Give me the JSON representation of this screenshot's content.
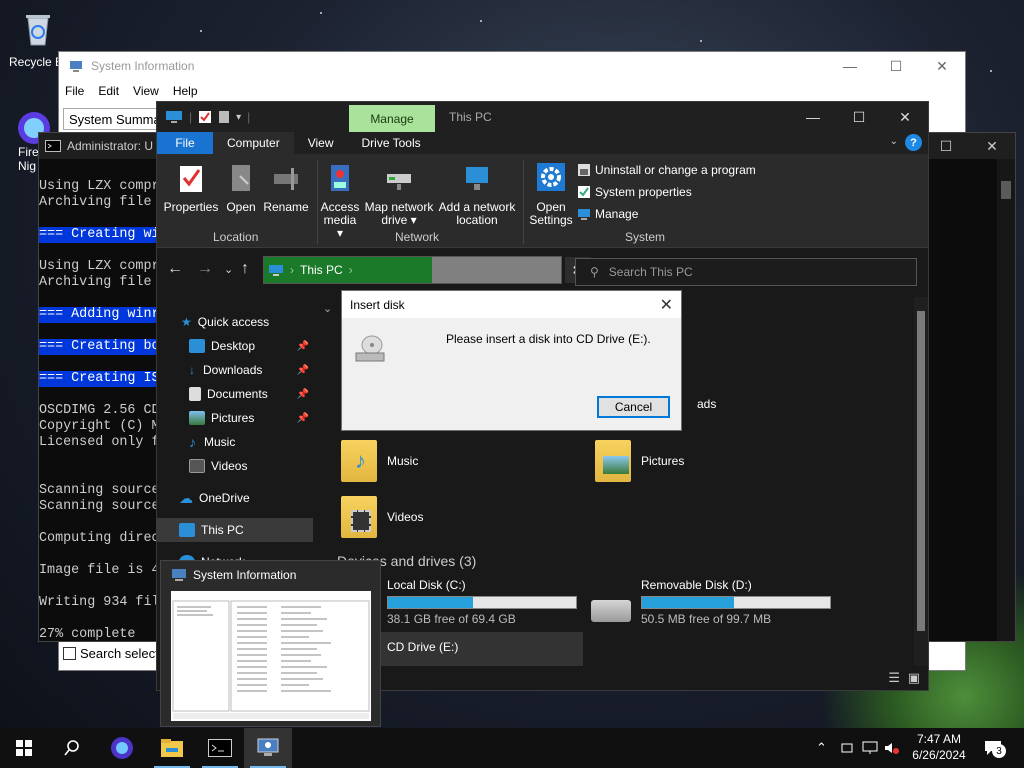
{
  "desktop": {
    "recycle_bin": "Recycle B",
    "firefox_label_1": "Fire",
    "firefox_label_2": "Nig"
  },
  "sysinfo": {
    "title": "System Information",
    "menu": [
      "File",
      "Edit",
      "View",
      "Help"
    ],
    "tree_head": "System Summa",
    "search_label": "Search select"
  },
  "cmd": {
    "title": "Administrator: U",
    "lines": [
      {
        "text": "Using LZX compr",
        "hl": false
      },
      {
        "text": "Archiving file",
        "hl": false
      },
      {
        "text": "",
        "hl": false
      },
      {
        "text": "=== Creating wi",
        "hl": true
      },
      {
        "text": "",
        "hl": false
      },
      {
        "text": "Using LZX compr",
        "hl": false
      },
      {
        "text": "Archiving file",
        "hl": false
      },
      {
        "text": "",
        "hl": false
      },
      {
        "text": "=== Adding winr",
        "hl": true
      },
      {
        "text": "",
        "hl": false
      },
      {
        "text": "=== Creating bo",
        "hl": true
      },
      {
        "text": "",
        "hl": false
      },
      {
        "text": "=== Creating IS",
        "hl": true
      },
      {
        "text": "",
        "hl": false
      },
      {
        "text": "OSCDIMG 2.56 CD",
        "hl": false
      },
      {
        "text": "Copyright (C) M",
        "hl": false
      },
      {
        "text": "Licensed only f",
        "hl": false
      },
      {
        "text": "",
        "hl": false
      },
      {
        "text": "",
        "hl": false
      },
      {
        "text": "Scanning source",
        "hl": false
      },
      {
        "text": "Scanning source",
        "hl": false
      },
      {
        "text": "",
        "hl": false
      },
      {
        "text": "Computing direc",
        "hl": false
      },
      {
        "text": "",
        "hl": false
      },
      {
        "text": "Image file is 4",
        "hl": false
      },
      {
        "text": "",
        "hl": false
      },
      {
        "text": "Writing 934 fil",
        "hl": false
      },
      {
        "text": "",
        "hl": false
      },
      {
        "text": "27% complete",
        "hl": false
      }
    ]
  },
  "explorer": {
    "context_tab": "Manage",
    "title": "This PC",
    "tabs": {
      "file": "File",
      "computer": "Computer",
      "view": "View",
      "drive_tools": "Drive Tools"
    },
    "ribbon": {
      "properties": "Properties",
      "open": "Open",
      "rename": "Rename",
      "access_media_1": "Access",
      "access_media_2": "media ▾",
      "map_drive_1": "Map network",
      "map_drive_2": "drive ▾",
      "add_location_1": "Add a network",
      "add_location_2": "location",
      "open_settings_1": "Open",
      "open_settings_2": "Settings",
      "uninstall": "Uninstall or change a program",
      "system_properties": "System properties",
      "manage": "Manage",
      "group_location": "Location",
      "group_network": "Network",
      "group_system": "System"
    },
    "address": "This PC",
    "search_placeholder": "Search This PC",
    "nav": {
      "quick_access": "Quick access",
      "desktop": "Desktop",
      "downloads": "Downloads",
      "documents": "Documents",
      "pictures": "Pictures",
      "music": "Music",
      "videos": "Videos",
      "onedrive": "OneDrive",
      "this_pc": "This PC",
      "network": "Network"
    },
    "content": {
      "music": "Music",
      "pictures": "Pictures",
      "videos": "Videos",
      "partial_downloads": "ads",
      "devices_header": "Devices and drives (3)",
      "drives": [
        {
          "name": "Local Disk (C:)",
          "free": "38.1 GB free of 69.4 GB",
          "used_fraction": 0.45
        },
        {
          "name": "Removable Disk (D:)",
          "free": "50.5 MB free of 99.7 MB",
          "used_fraction": 0.49
        },
        {
          "name": "CD Drive (E:)"
        }
      ]
    }
  },
  "dialog": {
    "title": "Insert disk",
    "message": "Please insert a disk into CD Drive (E:).",
    "cancel": "Cancel"
  },
  "thumbnail": {
    "title": "System Information"
  },
  "taskbar": {
    "time": "7:47 AM",
    "date": "6/26/2024",
    "notifications": "3"
  },
  "colors": {
    "accent": "#1973d1",
    "manage_tab": "#a9e29a",
    "address_green": "#1a7a2a",
    "cmd_highlight": "#0037da",
    "drive_fill": "#26a0da"
  }
}
